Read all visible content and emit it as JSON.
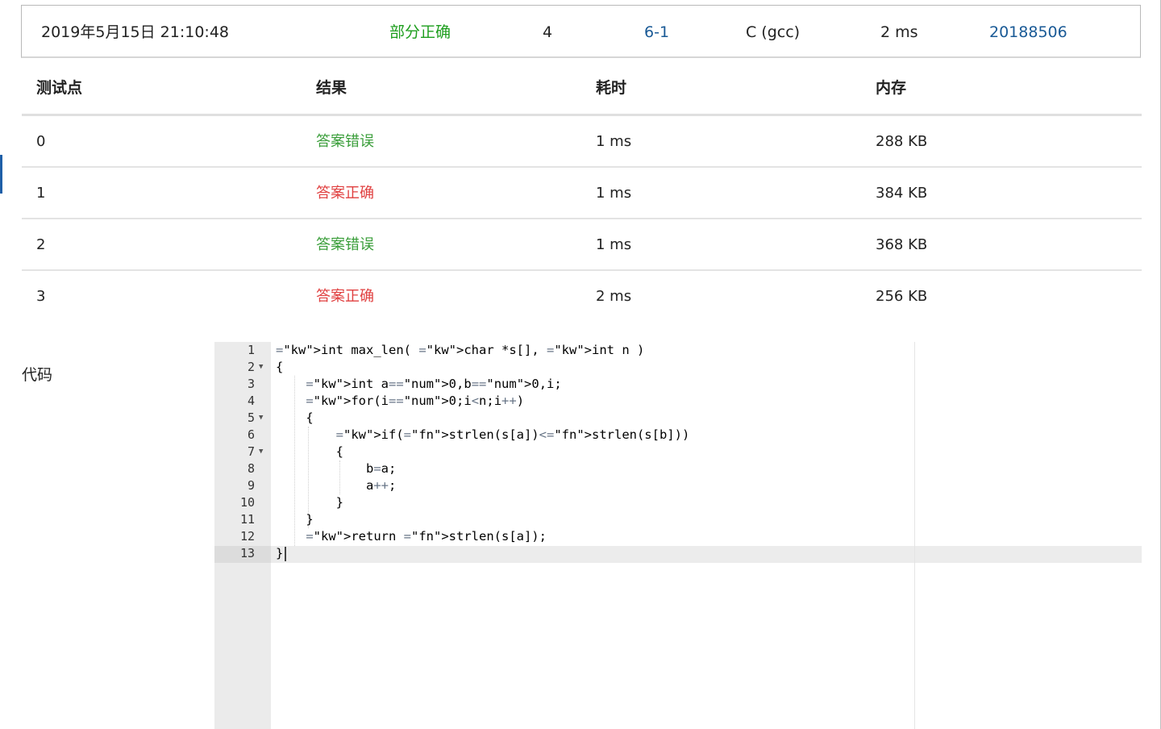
{
  "summary": {
    "time": "2019年5月15日 21:10:48",
    "status": "部分正确",
    "score": "4",
    "problem": "6-1",
    "language": "C (gcc)",
    "duration": "2 ms",
    "user": "20188506"
  },
  "cases": {
    "headers": [
      "测试点",
      "结果",
      "耗时",
      "内存"
    ],
    "rows": [
      {
        "id": "0",
        "result": "答案错误",
        "time": "1 ms",
        "memory": "288 KB"
      },
      {
        "id": "1",
        "result": "答案正确",
        "time": "1 ms",
        "memory": "384 KB"
      },
      {
        "id": "2",
        "result": "答案错误",
        "time": "1 ms",
        "memory": "368 KB"
      },
      {
        "id": "3",
        "result": "答案正确",
        "time": "2 ms",
        "memory": "256 KB"
      }
    ]
  },
  "code_label": "代码",
  "code": {
    "line_numbers": [
      "1",
      "2",
      "3",
      "4",
      "5",
      "6",
      "7",
      "8",
      "9",
      "10",
      "11",
      "12",
      "13"
    ],
    "lines": [
      "int max_len( char *s[], int n )",
      "{",
      "    int a=0,b=0,i;",
      "    for(i=0;i<n;i++)",
      "    {",
      "        if(strlen(s[a])<strlen(s[b]))",
      "        {",
      "            b=a;",
      "            a++;",
      "        }",
      "    }",
      "    return strlen(s[a]);",
      "}"
    ]
  },
  "icons": {
    "fold": "fold-arrow-icon"
  },
  "colors": {
    "status_partial": "#1d9e1d",
    "link": "#1a5a96",
    "result_wrong": "#3a9e3a",
    "result_right": "#e04040"
  }
}
